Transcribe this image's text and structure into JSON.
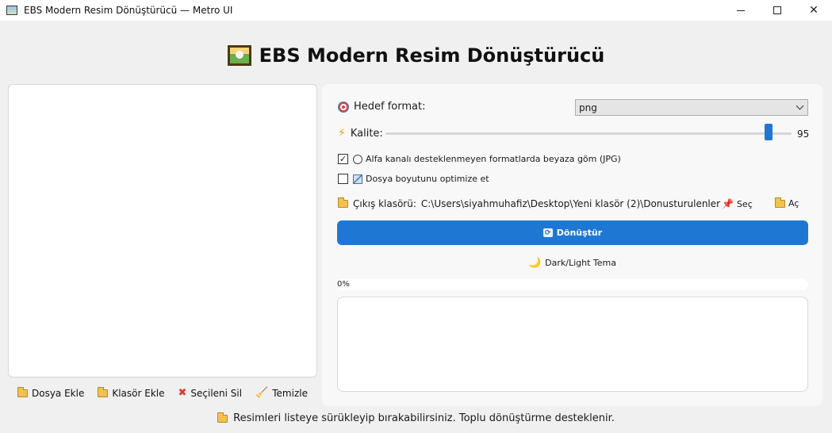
{
  "window": {
    "title": "EBS Modern Resim Dönüştürücü — Metro UI",
    "minimize_label": "",
    "maximize_label": "",
    "close_label": "✕"
  },
  "heading": {
    "text": "EBS Modern Resim Dönüştürücü"
  },
  "left_actions": {
    "add_file": "Dosya Ekle",
    "add_folder": "Klasör Ekle",
    "remove_selected": "Seçileni Sil",
    "clear": "Temizle"
  },
  "settings": {
    "target_format_label": "Hedef format:",
    "target_format_value": "png",
    "quality_label": "Kalite:",
    "quality_value": "95",
    "quality_level": 0.95,
    "alpha_checkbox_checked": true,
    "alpha_label": "Alfa kanalı desteklenmeyen formatlarda beyaza göm (JPG)",
    "optimize_checkbox_checked": false,
    "optimize_label": "Dosya boyutunu optimize et",
    "output_label": "Çıkış klasörü:",
    "output_path": "C:\\Users\\siyahmuhafiz\\Desktop\\Yeni klasör (2)\\Donusturulenler",
    "choose_label": "Seç",
    "open_label": "Aç",
    "convert_label": "Dönüştür",
    "theme_label": "Dark/Light Tema",
    "progress_text": "0%",
    "progress_value": 0
  },
  "status": {
    "text": "Resimleri listeye sürükleyip bırakabilirsiniz. Toplu dönüştürme desteklenir."
  },
  "colors": {
    "accent": "#1e78d3",
    "background": "#f0f0f0",
    "panel": "#f8f8f8"
  }
}
